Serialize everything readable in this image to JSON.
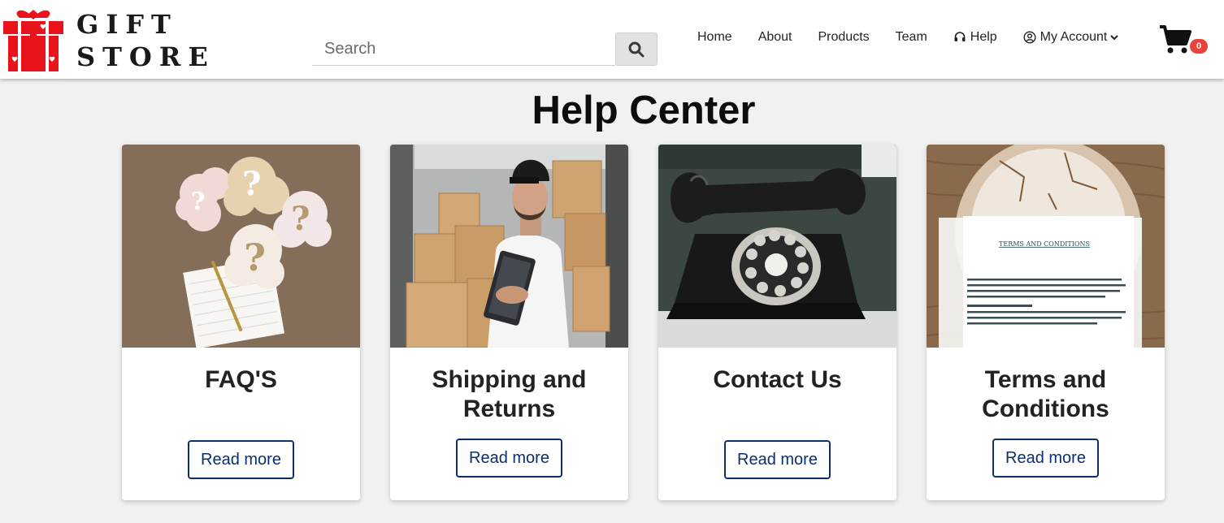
{
  "header": {
    "brand_line1": "GIFT",
    "brand_line2": "STORE",
    "search_placeholder": "Search",
    "nav": [
      {
        "label": "Home",
        "icon": null
      },
      {
        "label": "About",
        "icon": null
      },
      {
        "label": "Products",
        "icon": null
      },
      {
        "label": "Team",
        "icon": null
      },
      {
        "label": "Help",
        "icon": "headset-icon"
      },
      {
        "label": "My Account",
        "icon": "user-circle-icon"
      }
    ],
    "cart_count": "0"
  },
  "main": {
    "title": "Help Center",
    "cards": [
      {
        "title": "FAQ'S",
        "button": "Read more",
        "image": "question-marks-photo"
      },
      {
        "title": "Shipping and Returns",
        "button": "Read more",
        "image": "delivery-man-boxes-photo"
      },
      {
        "title": "Contact Us",
        "button": "Read more",
        "image": "rotary-phone-photo"
      },
      {
        "title": "Terms and Conditions",
        "button": "Read more",
        "image": "magnified-document-photo"
      }
    ]
  },
  "colors": {
    "accent": "#0b2e6d",
    "logo_red": "#e8131b",
    "badge": "#e8423b",
    "background": "#f1f1f1"
  }
}
